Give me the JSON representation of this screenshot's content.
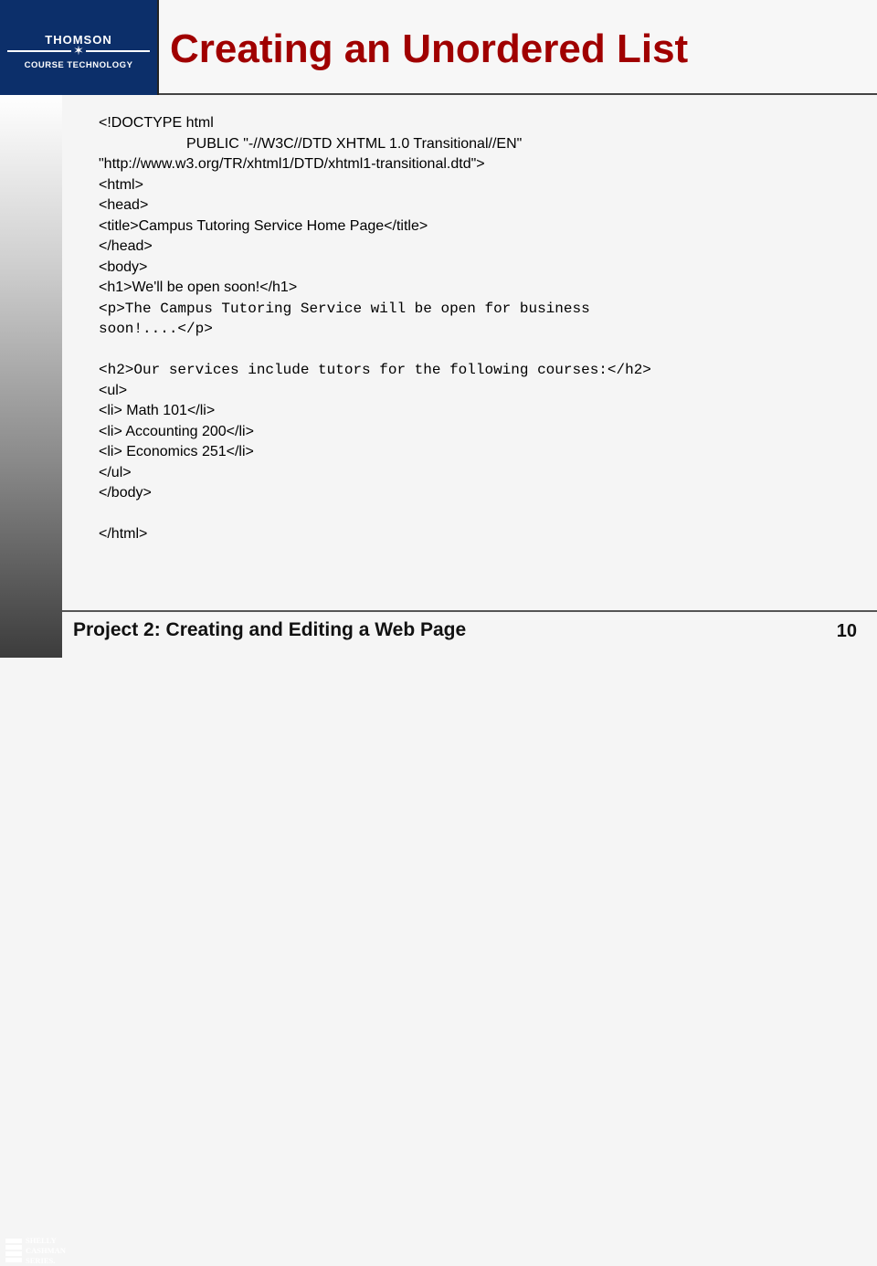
{
  "logo": {
    "top": "THOMSON",
    "bottom": "COURSE TECHNOLOGY"
  },
  "slide": {
    "title": "Creating an Unordered List",
    "lines": [
      "<!DOCTYPE html",
      "PUBLIC \"-//W3C//DTD XHTML 1.0 Transitional//EN\"",
      "\"http://www.w3.org/TR/xhtml1/DTD/xhtml1-transitional.dtd\">",
      "<html>",
      "<head>",
      "<title>Campus Tutoring Service Home Page</title>",
      "</head>",
      "<body>",
      "<h1>We'll be open soon!</h1>",
      "<p>The Campus Tutoring Service will be open for business",
      "soon!....</p>",
      "<h2>Our services include tutors for the following courses:</h2>",
      "<ul>",
      "<li> Math 101</li>",
      "<li> Accounting 200</li>",
      "<li> Economics 251</li>",
      "</ul>",
      "</body>",
      "</html>"
    ]
  },
  "footer": {
    "text": "Project 2: Creating and Editing a Web Page",
    "page_number": "10"
  },
  "series_logo": {
    "line1": "SHELLY",
    "line2": "CASHMAN",
    "line3": "SERIES."
  },
  "colors": {
    "title": "#a00000",
    "logo_bg": "#0c2f6a"
  }
}
